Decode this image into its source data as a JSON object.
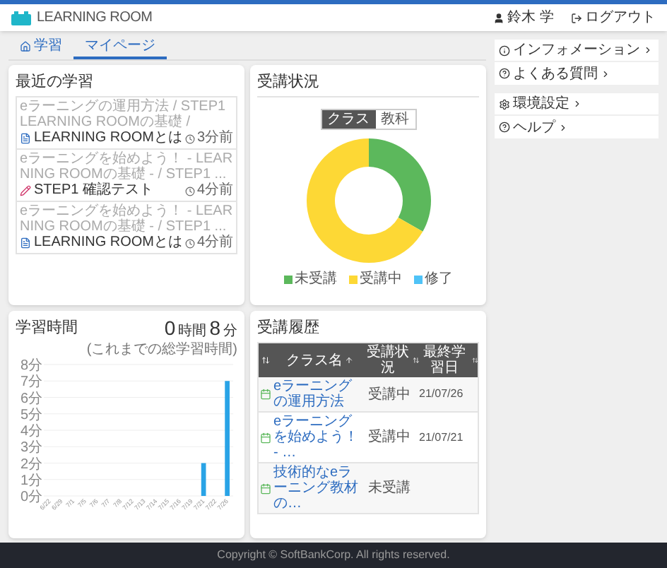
{
  "header": {
    "logo": "LEARNING ROOM",
    "user": "鈴木 学",
    "logout": "ログアウト"
  },
  "tabs": [
    {
      "label": "学習",
      "selected": false,
      "kind": "home"
    },
    {
      "label": "マイページ",
      "selected": true,
      "kind": "plain"
    }
  ],
  "recent": {
    "title": "最近の学習",
    "items": [
      {
        "path": "eラーニングの運用方法 / STEP1 LEARNING ROOMの基礎 /",
        "title": "LEARNING ROOMとは",
        "kind": "page",
        "time": "3分前"
      },
      {
        "path": "eラーニングを始めよう！ - LEARNING ROOMの基礎 - / STEP1 ...",
        "title": "STEP1 確認テスト",
        "kind": "test",
        "time": "4分前"
      },
      {
        "path": "eラーニングを始めよう！ - LEARNING ROOMの基礎 - / STEP1 ...",
        "title": "LEARNING ROOMとは",
        "kind": "page",
        "time": "4分前"
      }
    ]
  },
  "status": {
    "title": "受講状況",
    "toggle": [
      {
        "label": "クラス",
        "selected": true
      },
      {
        "label": "教科",
        "selected": false
      }
    ],
    "chart_data": {
      "type": "donut",
      "categories": [
        "未受講",
        "受講中",
        "修了"
      ],
      "values": [
        33.3,
        66.7,
        0
      ],
      "legend": "bottom",
      "colors": [
        "#5cb85c",
        "#fdd835",
        "#4fc3f7"
      ]
    }
  },
  "time": {
    "title": "学習時間",
    "hours": "0",
    "hours_unit": "時間",
    "minutes": "8",
    "minutes_unit": "分",
    "note": "(これまでの総学習時間)",
    "chart_data": {
      "type": "bar",
      "categories": [
        "6/22",
        "6/29",
        "7/1",
        "7/5",
        "7/6",
        "7/7",
        "7/8",
        "7/12",
        "7/13",
        "7/14",
        "7/15",
        "7/16",
        "7/19",
        "7/21",
        "7/22",
        "7/26"
      ],
      "values": [
        0,
        0,
        0,
        0,
        0,
        0,
        0,
        0,
        0,
        0,
        0,
        0,
        0,
        2,
        0,
        7
      ],
      "ylim": [
        0,
        8
      ],
      "grid": true,
      "yticks": [
        {
          "value": 0,
          "label": "0分"
        },
        {
          "value": 1,
          "label": "1分"
        },
        {
          "value": 2,
          "label": "2分"
        },
        {
          "value": 3,
          "label": "3分"
        },
        {
          "value": 4,
          "label": "4分"
        },
        {
          "value": 5,
          "label": "5分"
        },
        {
          "value": 6,
          "label": "6分"
        },
        {
          "value": 7,
          "label": "7分"
        },
        {
          "value": 8,
          "label": "8分"
        }
      ]
    }
  },
  "history": {
    "title": "受講履歴",
    "columns": [
      "クラス名",
      "受講状況",
      "最終学習日"
    ],
    "rows": [
      {
        "name": "eラーニングの運用方法",
        "status": "受講中",
        "date": "21/07/26"
      },
      {
        "name": "eラーニングを始めよう！ - …",
        "status": "受講中",
        "date": "21/07/21"
      },
      {
        "name": "技術的なeラーニング教材の…",
        "status": "未受講"
      }
    ]
  },
  "sidebar": [
    [
      {
        "label": "インフォメーション",
        "kind": "info"
      },
      {
        "label": "よくある質問",
        "kind": "faq"
      }
    ],
    [
      {
        "label": "環境設定",
        "kind": "settings"
      },
      {
        "label": "ヘルプ",
        "kind": "help"
      }
    ]
  ],
  "footer": "Copyright © SoftBankCorp. All rights reserved."
}
